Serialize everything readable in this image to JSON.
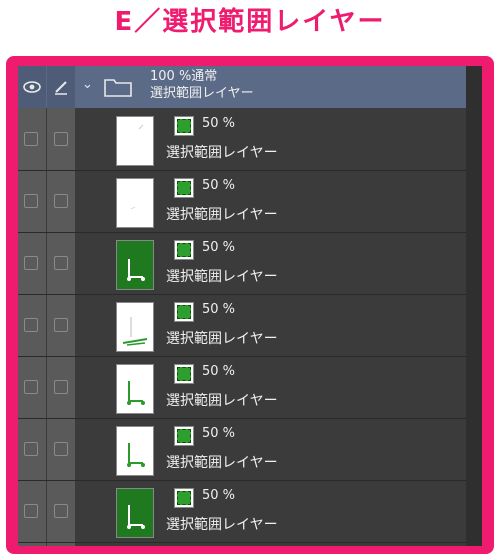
{
  "heading": "E／選択範囲レイヤー",
  "colors": {
    "accent": "#ee1b6f",
    "panel": "#3b3b3b",
    "folder_row": "#5b6a86",
    "selection_green": "#2e9e2e"
  },
  "folder": {
    "icons": [
      "eye-icon",
      "pen-icon",
      "chevron-down-icon",
      "folder-icon"
    ],
    "mode": "100 %通常",
    "name": "選択範囲レイヤー"
  },
  "layers": [
    {
      "opacity": "50 %",
      "name": "選択範囲レイヤー",
      "thumbnail": "white-sketch"
    },
    {
      "opacity": "50 %",
      "name": "選択範囲レイヤー",
      "thumbnail": "white-sketch"
    },
    {
      "opacity": "50 %",
      "name": "選択範囲レイヤー",
      "thumbnail": "green-fill"
    },
    {
      "opacity": "50 %",
      "name": "選択範囲レイヤー",
      "thumbnail": "white-green-lines"
    },
    {
      "opacity": "50 %",
      "name": "選択範囲レイヤー",
      "thumbnail": "white-green-lines"
    },
    {
      "opacity": "50 %",
      "name": "選択範囲レイヤー",
      "thumbnail": "white-green-lines"
    },
    {
      "opacity": "50 %",
      "name": "選択範囲レイヤー",
      "thumbnail": "green-fill"
    }
  ]
}
